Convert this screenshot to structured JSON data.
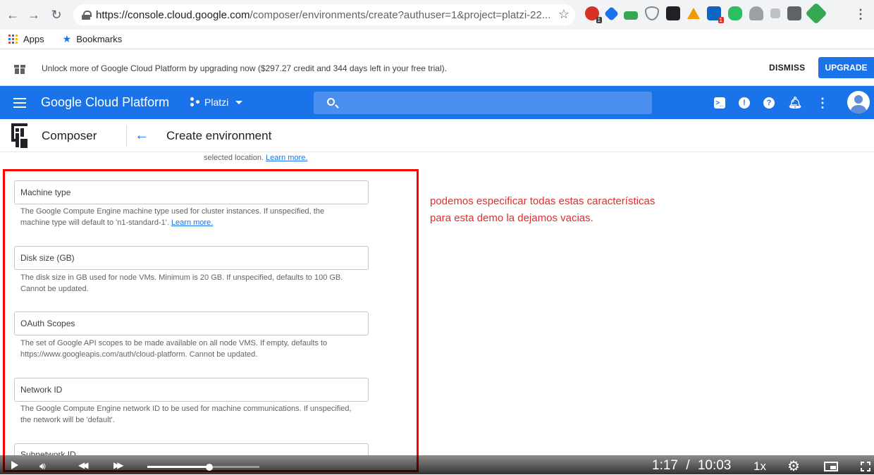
{
  "browser": {
    "url_host": "https://console.cloud.google.com",
    "url_path": "/composer/environments/create?authuser=1&project=platzi-22...",
    "bookmarks": [
      {
        "label": "Apps"
      },
      {
        "label": "Bookmarks"
      }
    ],
    "extension_badges": [
      "1",
      "1"
    ]
  },
  "banner": {
    "text": "Unlock more of Google Cloud Platform by upgrading now ($297.27 credit and 344 days left in your free trial).",
    "dismiss_label": "DISMISS",
    "upgrade_label": "UPGRADE"
  },
  "gcp_header": {
    "title": "Google Cloud Platform",
    "project": "Platzi"
  },
  "subheader": {
    "product": "Composer",
    "page_title": "Create environment"
  },
  "form": {
    "location_hint": "selected location.",
    "location_link": "Learn more.",
    "fields": [
      {
        "placeholder": "Machine type",
        "help": "The Google Compute Engine machine type used for cluster instances. If unspecified, the machine type will default to 'n1-standard-1'.",
        "help_link": "Learn more."
      },
      {
        "placeholder": "Disk size (GB)",
        "help": "The disk size in GB used for node VMs. Minimum is 20 GB. If unspecified, defaults to 100 GB. Cannot be updated."
      },
      {
        "placeholder": "OAuth Scopes",
        "help": "The set of Google API scopes to be made available on all node VMS. If empty, defaults to https://www.googleapis.com/auth/cloud-platform. Cannot be updated."
      },
      {
        "placeholder": "Network ID",
        "help": "The Google Compute Engine network ID to be used for machine communications. If unspecified, the network will be 'default'."
      },
      {
        "placeholder": "Subnetwork ID"
      }
    ]
  },
  "annotation": {
    "line1": "podemos especificar todas estas características",
    "line2": "para esta demo la dejamos vacias.",
    "color": "#e52b2b"
  },
  "player": {
    "current_time": "1:17",
    "separator": "/",
    "duration": "10:03",
    "speed": "1x",
    "progress": 0.13
  },
  "colors": {
    "gcp_blue": "#1a73e8",
    "annotation_red": "#ff0000"
  }
}
